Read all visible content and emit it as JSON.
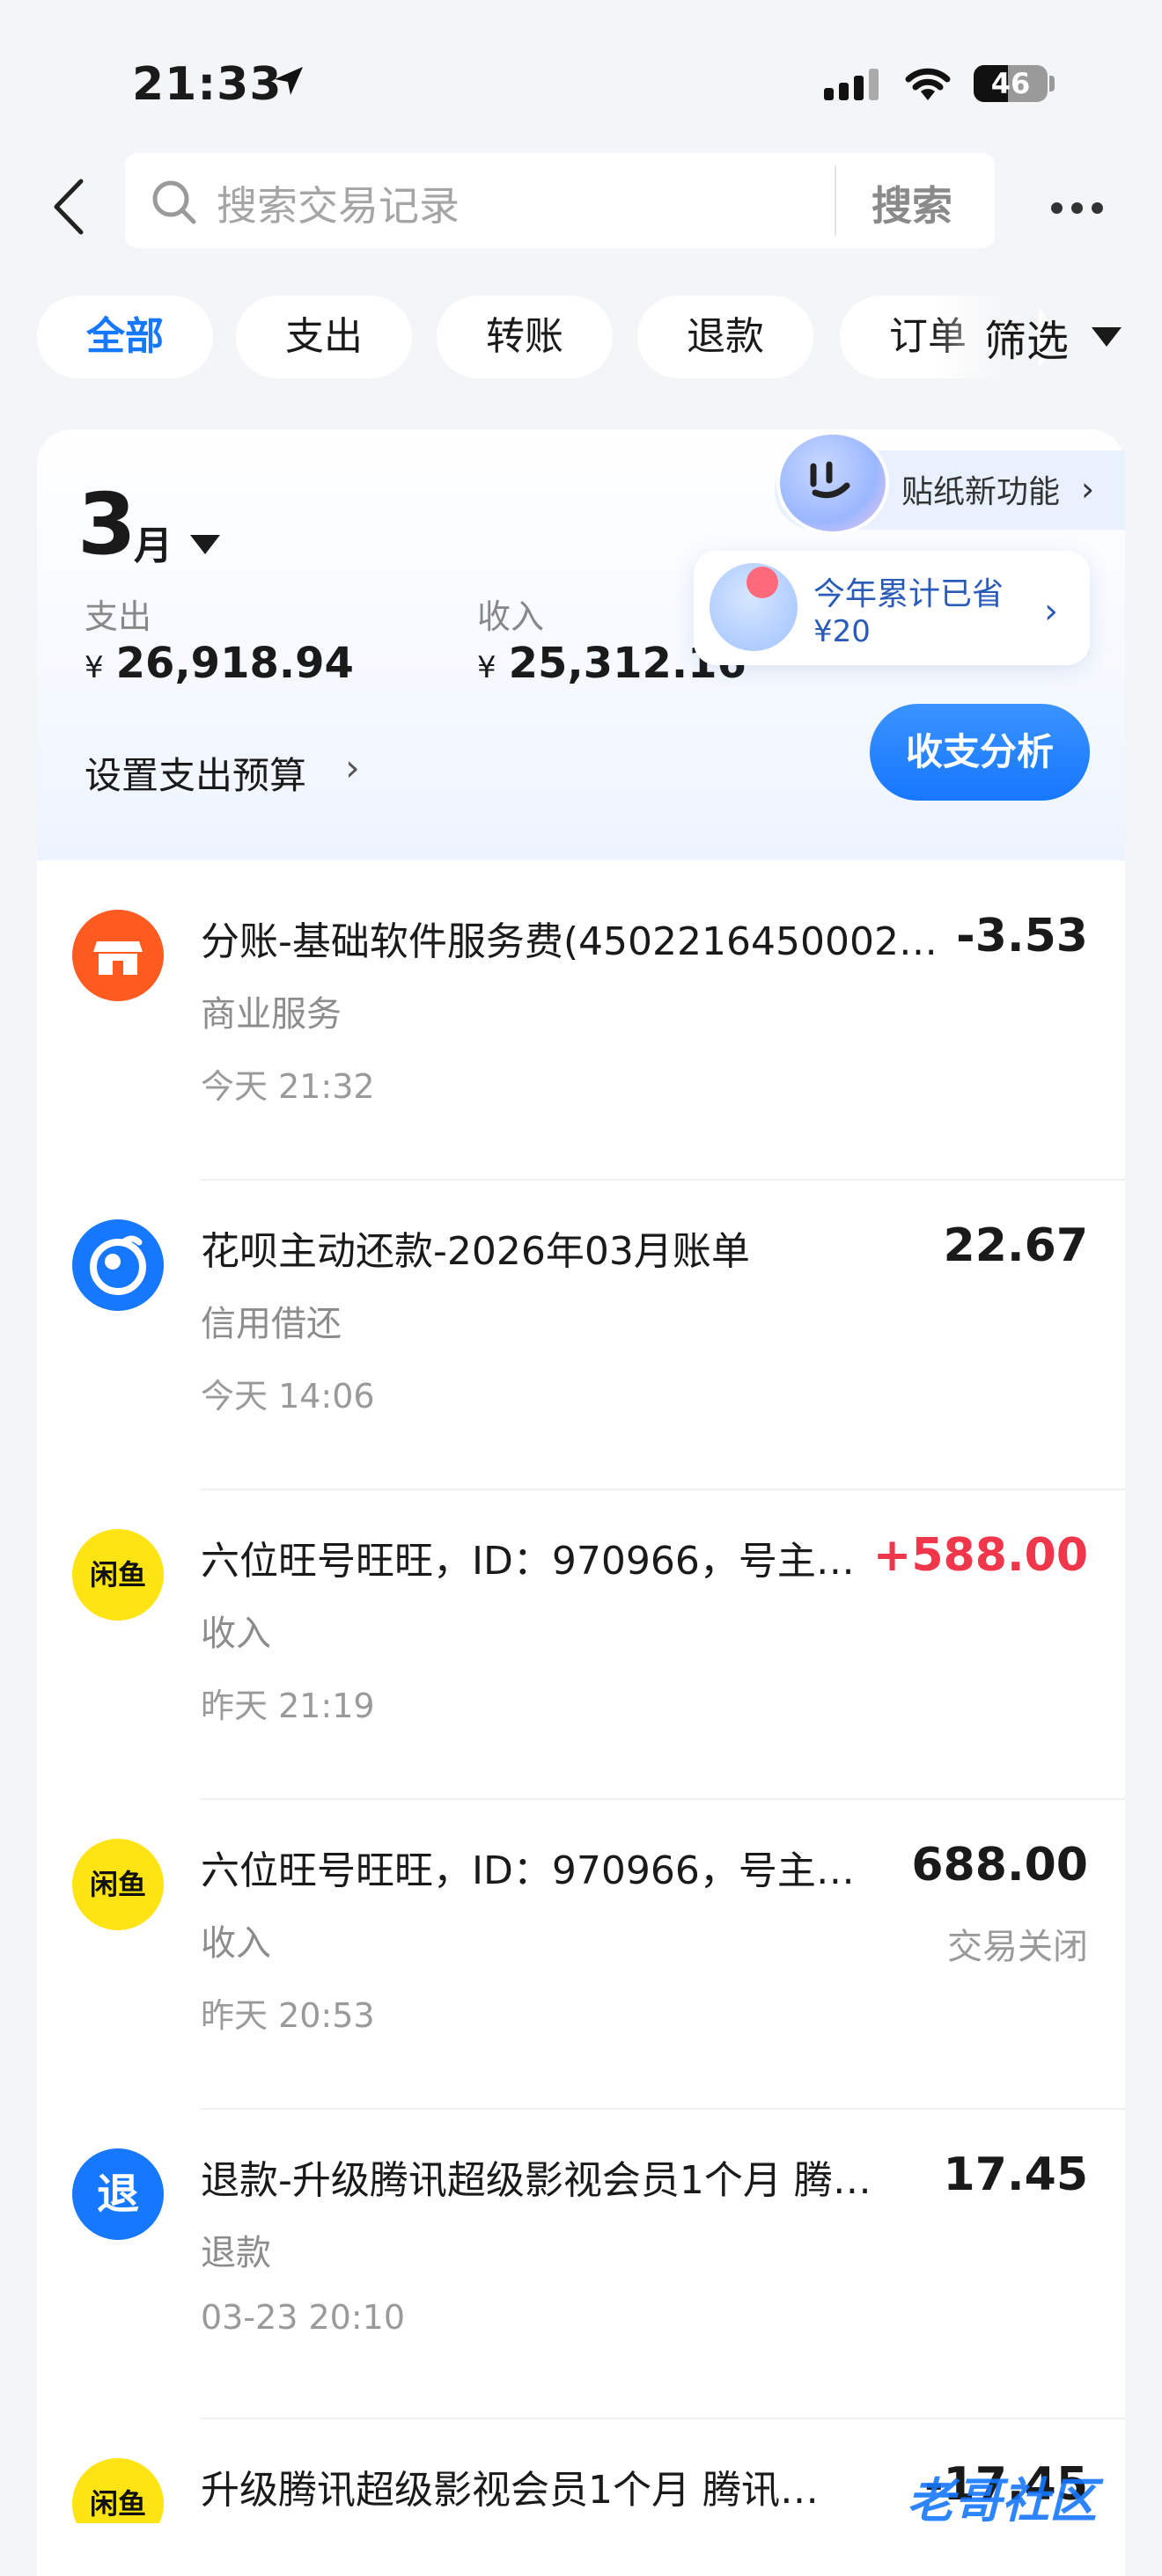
{
  "status_bar": {
    "time": "21:33",
    "battery": "46"
  },
  "header": {
    "search_placeholder": "搜索交易记录",
    "search_button": "搜索"
  },
  "filters": {
    "chips": [
      "全部",
      "支出",
      "转账",
      "退款",
      "订单"
    ],
    "active": "全部",
    "filter_label": "筛选"
  },
  "summary": {
    "month": "3",
    "month_unit": "月",
    "expense_label": "支出",
    "expense_currency": "¥",
    "expense_amount": "26,918.94",
    "income_label": "收入",
    "income_currency": "¥",
    "income_amount": "25,312.16",
    "budget_label": "设置支出预算",
    "sticker_label": "贴纸新功能",
    "save_title": "今年累计已省",
    "save_amount": "¥20",
    "analysis_button": "收支分析"
  },
  "transactions": [
    {
      "icon": "store-icon",
      "icon_color": "#ff5a1f",
      "title": "分账-基础软件服务费(4502216450002…",
      "category": "商业服务",
      "time": "今天 21:32",
      "amount": "-3.53",
      "amount_color": "#1a1a1a",
      "status": ""
    },
    {
      "icon": "huabei-icon",
      "icon_color": "#1677ff",
      "title": "花呗主动还款-2026年03月账单",
      "category": "信用借还",
      "time": "今天 14:06",
      "amount": "22.67",
      "amount_color": "#1a1a1a",
      "status": ""
    },
    {
      "icon": "xianyu-icon",
      "icon_color": "#ffe414",
      "icon_text": "闲鱼",
      "title": "六位旺号旺旺，ID：970966，号主…",
      "category": "收入",
      "time": "昨天 21:19",
      "amount": "+588.00",
      "amount_color": "#f0364a",
      "status": ""
    },
    {
      "icon": "xianyu-icon",
      "icon_color": "#ffe414",
      "icon_text": "闲鱼",
      "title": "六位旺号旺旺，ID：970966，号主…",
      "category": "收入",
      "time": "昨天 20:53",
      "amount": "688.00",
      "amount_color": "#1a1a1a",
      "status": "交易关闭"
    },
    {
      "icon": "refund-icon",
      "icon_color": "#1677ff",
      "icon_text": "退",
      "title": "退款-升级腾讯超级影视会员1个月 腾…",
      "category": "退款",
      "time": "03-23 20:10",
      "amount": "17.45",
      "amount_color": "#1a1a1a",
      "status": ""
    },
    {
      "icon": "xianyu-icon",
      "icon_color": "#ffe414",
      "icon_text": "闲鱼",
      "title": "升级腾讯超级影视会员1个月 腾讯…",
      "category": "",
      "time": "",
      "amount": "-17.45",
      "amount_color": "#1a1a1a",
      "status": ""
    }
  ],
  "watermark": "老哥社区"
}
